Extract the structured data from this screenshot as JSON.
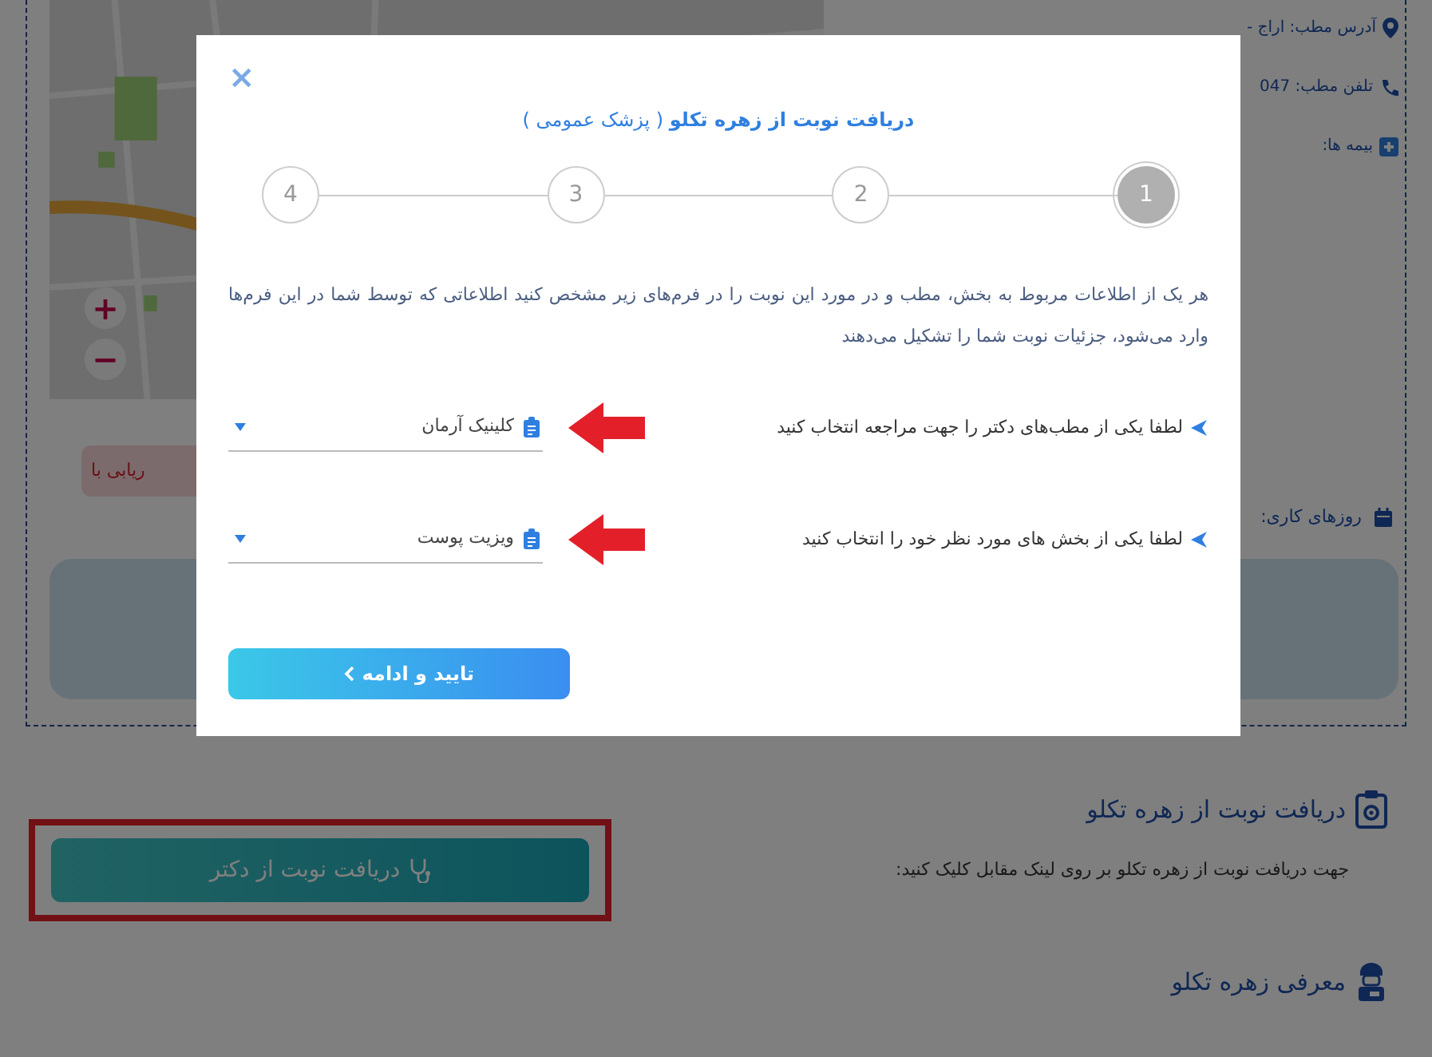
{
  "background_page": {
    "address": "آدرس مطب: اراج -",
    "phone": "تلفن مطب: 047",
    "insurance": "بیمه ها:",
    "working_days": "روزهای کاری:",
    "map": {
      "kind": "picture",
      "zoom_in": "+",
      "zoom_out": "−"
    },
    "route_button": "ریابی با"
  },
  "modal": {
    "close": "×",
    "title": "**دریافت نوبت از زهره تکلو** ( پزشک عمومی )",
    "steps": [
      {
        "label": "1",
        "selected": true
      },
      {
        "label": "2",
        "selected": false
      },
      {
        "label": "3",
        "selected": false
      },
      {
        "label": "4",
        "selected": false
      }
    ],
    "description": "هر یک از اطلاعات مربوط به بخش، مطب و در مورد این نوبت را در فرم‌های زیر مشخص کنید اطلاعاتی که توسط شما در این فرم‌ها وارد می‌شود، جزئیات نوبت شما را تشکیل می‌دهند",
    "fields": [
      {
        "label": "لطفا یکی از مطب‌های دکتر را جهت مراجعه انتخاب کنید",
        "value": "کلینیک آرمان",
        "annotated": true
      },
      {
        "label": "لطفا یکی از بخش های مورد نظر خود را انتخاب کنید",
        "value": "ویزیت پوست",
        "annotated": true
      }
    ],
    "submit": "تایید و ادامه"
  },
  "booking_section": {
    "heading": "دریافت نوبت از زهره تکلو",
    "text": "جهت دریافت نوبت از زهره تکلو بر روی لینک مقابل کلیک کنید:",
    "button": "دریافت نوبت از دکتر",
    "highlighted": true
  },
  "intro_section": {
    "heading": "معرفی زهره تکلو"
  }
}
